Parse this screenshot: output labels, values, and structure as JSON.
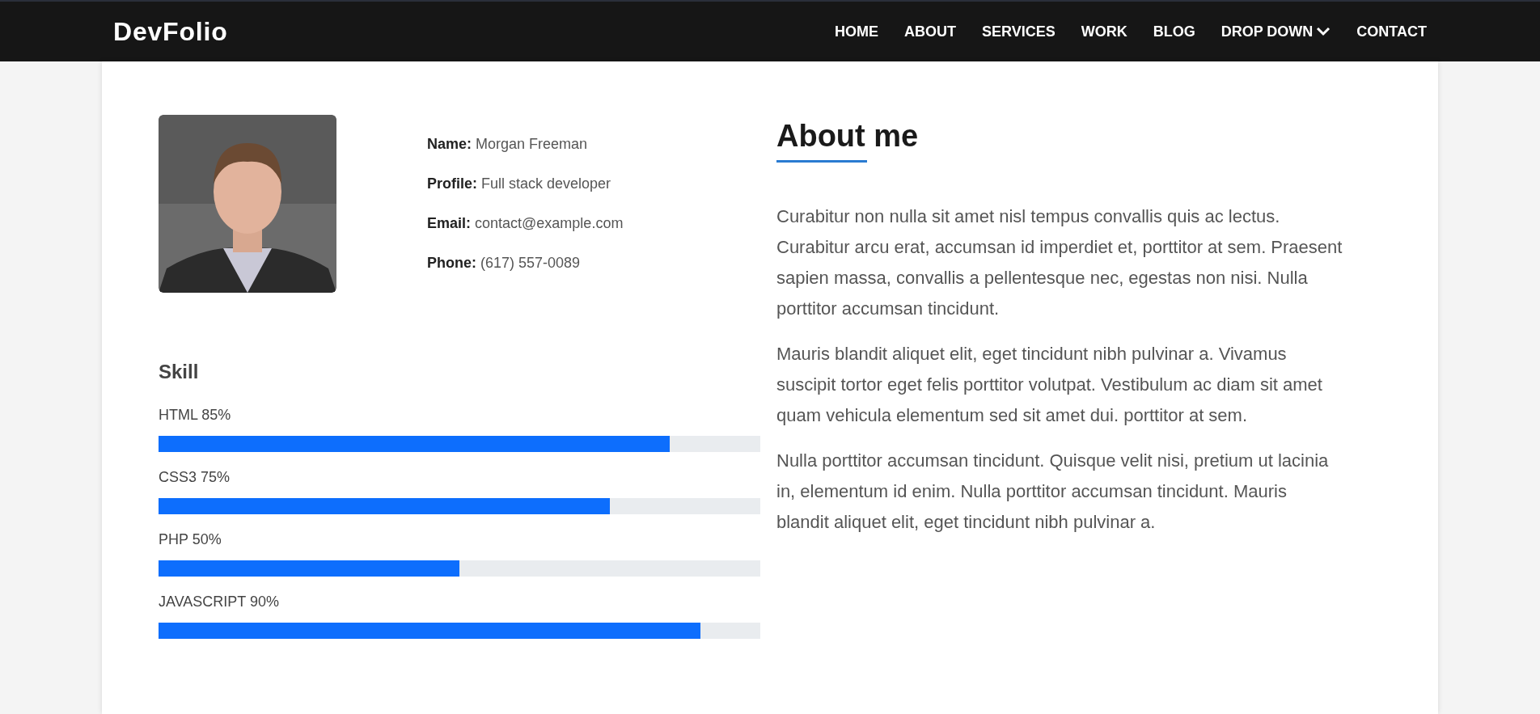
{
  "navbar": {
    "logo": "DevFolio",
    "items": [
      {
        "label": "HOME",
        "kind": "link"
      },
      {
        "label": "ABOUT",
        "kind": "link"
      },
      {
        "label": "SERVICES",
        "kind": "link"
      },
      {
        "label": "WORK",
        "kind": "link"
      },
      {
        "label": "BLOG",
        "kind": "link"
      },
      {
        "label": "DROP DOWN",
        "kind": "dropdown"
      },
      {
        "label": "CONTACT",
        "kind": "link"
      }
    ]
  },
  "profile": {
    "details": [
      "**Name:** Morgan Freeman",
      "**Profile:** Full stack developer",
      "**Email:** contact@example.com",
      "**Phone:** (617) 557-0089"
    ]
  },
  "skills": {
    "title": "Skill",
    "items": [
      {
        "label": "HTML 85%",
        "level": 0.85
      },
      {
        "label": "CSS3 75%",
        "level": 0.75
      },
      {
        "label": "PHP 50%",
        "level": 0.5
      },
      {
        "label": "JAVASCRIPT 90%",
        "level": 0.9
      }
    ]
  },
  "about": {
    "title": "About me",
    "paragraphs": [
      "Curabitur non nulla sit amet nisl tempus convallis quis ac lectus. Curabitur arcu erat, accumsan id imperdiet et, porttitor at sem. Praesent sapien massa, convallis a pellentesque nec, egestas non nisi. Nulla porttitor accumsan tincidunt.",
      "Mauris blandit aliquet elit, eget tincidunt nibh pulvinar a. Vivamus suscipit tortor eget felis porttitor volutpat. Vestibulum ac diam sit amet quam vehicula elementum sed sit amet dui. porttitor at sem.",
      "Nulla porttitor accumsan tincidunt. Quisque velit nisi, pretium ut lacinia in, elementum id enim. Nulla porttitor accumsan tincidunt. Mauris blandit aliquet elit, eget tincidunt nibh pulvinar a."
    ]
  }
}
